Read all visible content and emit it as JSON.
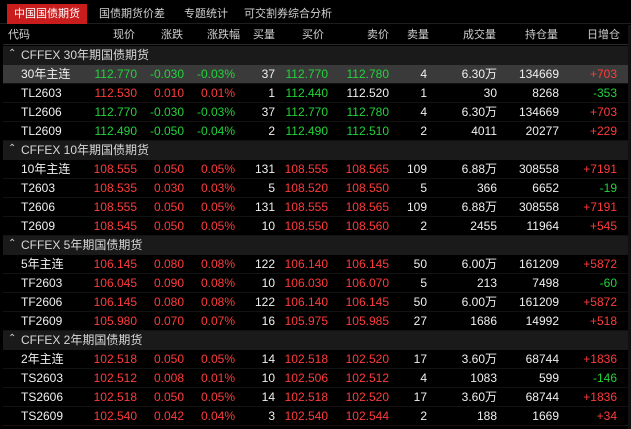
{
  "tabs": [
    {
      "label": "中国国债期货",
      "active": true
    },
    {
      "label": "国债期货价差",
      "active": false
    },
    {
      "label": "专题统计",
      "active": false
    },
    {
      "label": "可交割券综合分析",
      "active": false
    }
  ],
  "columns": [
    "代码",
    "现价",
    "涨跌",
    "涨跌幅",
    "买量",
    "买价",
    "卖价",
    "卖量",
    "成交量",
    "持仓量",
    "日增仓"
  ],
  "groups": [
    {
      "title": "CFFEX 30年期国债期货",
      "rows": [
        {
          "name": "30年主连",
          "price": "112.770",
          "change": "-0.030",
          "pct": "-0.03%",
          "bid_vol": "37",
          "bid": "112.770",
          "ask": "112.780",
          "ask_vol": "4",
          "volume": "6.30万",
          "oi": "134669",
          "oi_chg": "+703",
          "dir": "green",
          "bid_dir": "green",
          "ask_dir": "green",
          "oi_dir": "red",
          "selected": true
        },
        {
          "name": "TL2603",
          "price": "112.530",
          "change": "0.010",
          "pct": "0.01%",
          "bid_vol": "1",
          "bid": "112.440",
          "ask": "112.520",
          "ask_vol": "1",
          "volume": "30",
          "oi": "8268",
          "oi_chg": "-353",
          "dir": "red",
          "bid_dir": "green",
          "ask_dir": "white",
          "oi_dir": "green",
          "selected": false
        },
        {
          "name": "TL2606",
          "price": "112.770",
          "change": "-0.030",
          "pct": "-0.03%",
          "bid_vol": "37",
          "bid": "112.770",
          "ask": "112.780",
          "ask_vol": "4",
          "volume": "6.30万",
          "oi": "134669",
          "oi_chg": "+703",
          "dir": "green",
          "bid_dir": "green",
          "ask_dir": "green",
          "oi_dir": "red",
          "selected": false
        },
        {
          "name": "TL2609",
          "price": "112.490",
          "change": "-0.050",
          "pct": "-0.04%",
          "bid_vol": "2",
          "bid": "112.490",
          "ask": "112.510",
          "ask_vol": "2",
          "volume": "4011",
          "oi": "20277",
          "oi_chg": "+229",
          "dir": "green",
          "bid_dir": "green",
          "ask_dir": "green",
          "oi_dir": "red",
          "selected": false
        }
      ]
    },
    {
      "title": "CFFEX 10年期国债期货",
      "rows": [
        {
          "name": "10年主连",
          "price": "108.555",
          "change": "0.050",
          "pct": "0.05%",
          "bid_vol": "131",
          "bid": "108.555",
          "ask": "108.565",
          "ask_vol": "109",
          "volume": "6.88万",
          "oi": "308558",
          "oi_chg": "+7191",
          "dir": "red",
          "bid_dir": "red",
          "ask_dir": "red",
          "oi_dir": "red",
          "selected": false
        },
        {
          "name": "T2603",
          "price": "108.535",
          "change": "0.030",
          "pct": "0.03%",
          "bid_vol": "5",
          "bid": "108.520",
          "ask": "108.550",
          "ask_vol": "5",
          "volume": "366",
          "oi": "6652",
          "oi_chg": "-19",
          "dir": "red",
          "bid_dir": "red",
          "ask_dir": "red",
          "oi_dir": "green",
          "selected": false
        },
        {
          "name": "T2606",
          "price": "108.555",
          "change": "0.050",
          "pct": "0.05%",
          "bid_vol": "131",
          "bid": "108.555",
          "ask": "108.565",
          "ask_vol": "109",
          "volume": "6.88万",
          "oi": "308558",
          "oi_chg": "+7191",
          "dir": "red",
          "bid_dir": "red",
          "ask_dir": "red",
          "oi_dir": "red",
          "selected": false
        },
        {
          "name": "T2609",
          "price": "108.545",
          "change": "0.050",
          "pct": "0.05%",
          "bid_vol": "10",
          "bid": "108.550",
          "ask": "108.560",
          "ask_vol": "2",
          "volume": "2455",
          "oi": "11964",
          "oi_chg": "+545",
          "dir": "red",
          "bid_dir": "red",
          "ask_dir": "red",
          "oi_dir": "red",
          "selected": false
        }
      ]
    },
    {
      "title": "CFFEX 5年期国债期货",
      "rows": [
        {
          "name": "5年主连",
          "price": "106.145",
          "change": "0.080",
          "pct": "0.08%",
          "bid_vol": "122",
          "bid": "106.140",
          "ask": "106.145",
          "ask_vol": "50",
          "volume": "6.00万",
          "oi": "161209",
          "oi_chg": "+5872",
          "dir": "red",
          "bid_dir": "red",
          "ask_dir": "red",
          "oi_dir": "red",
          "selected": false
        },
        {
          "name": "TF2603",
          "price": "106.045",
          "change": "0.090",
          "pct": "0.08%",
          "bid_vol": "10",
          "bid": "106.030",
          "ask": "106.070",
          "ask_vol": "5",
          "volume": "213",
          "oi": "7498",
          "oi_chg": "-60",
          "dir": "red",
          "bid_dir": "red",
          "ask_dir": "red",
          "oi_dir": "green",
          "selected": false
        },
        {
          "name": "TF2606",
          "price": "106.145",
          "change": "0.080",
          "pct": "0.08%",
          "bid_vol": "122",
          "bid": "106.140",
          "ask": "106.145",
          "ask_vol": "50",
          "volume": "6.00万",
          "oi": "161209",
          "oi_chg": "+5872",
          "dir": "red",
          "bid_dir": "red",
          "ask_dir": "red",
          "oi_dir": "red",
          "selected": false
        },
        {
          "name": "TF2609",
          "price": "105.980",
          "change": "0.070",
          "pct": "0.07%",
          "bid_vol": "16",
          "bid": "105.975",
          "ask": "105.985",
          "ask_vol": "27",
          "volume": "1686",
          "oi": "14992",
          "oi_chg": "+518",
          "dir": "red",
          "bid_dir": "red",
          "ask_dir": "red",
          "oi_dir": "red",
          "selected": false
        }
      ]
    },
    {
      "title": "CFFEX 2年期国债期货",
      "rows": [
        {
          "name": "2年主连",
          "price": "102.518",
          "change": "0.050",
          "pct": "0.05%",
          "bid_vol": "14",
          "bid": "102.518",
          "ask": "102.520",
          "ask_vol": "17",
          "volume": "3.60万",
          "oi": "68744",
          "oi_chg": "+1836",
          "dir": "red",
          "bid_dir": "red",
          "ask_dir": "red",
          "oi_dir": "red",
          "selected": false
        },
        {
          "name": "TS2603",
          "price": "102.512",
          "change": "0.008",
          "pct": "0.01%",
          "bid_vol": "10",
          "bid": "102.506",
          "ask": "102.512",
          "ask_vol": "4",
          "volume": "1083",
          "oi": "599",
          "oi_chg": "-146",
          "dir": "red",
          "bid_dir": "red",
          "ask_dir": "red",
          "oi_dir": "green",
          "selected": false
        },
        {
          "name": "TS2606",
          "price": "102.518",
          "change": "0.050",
          "pct": "0.05%",
          "bid_vol": "14",
          "bid": "102.518",
          "ask": "102.520",
          "ask_vol": "17",
          "volume": "3.60万",
          "oi": "68744",
          "oi_chg": "+1836",
          "dir": "red",
          "bid_dir": "red",
          "ask_dir": "red",
          "oi_dir": "red",
          "selected": false
        },
        {
          "name": "TS2609",
          "price": "102.540",
          "change": "0.042",
          "pct": "0.04%",
          "bid_vol": "3",
          "bid": "102.540",
          "ask": "102.544",
          "ask_vol": "2",
          "volume": "188",
          "oi": "1669",
          "oi_chg": "+34",
          "dir": "red",
          "bid_dir": "red",
          "ask_dir": "red",
          "oi_dir": "red",
          "selected": false
        }
      ]
    }
  ],
  "colors": {
    "up": "#ff3b3b",
    "down": "#22d33a",
    "tab_active": "#c91d1d"
  }
}
